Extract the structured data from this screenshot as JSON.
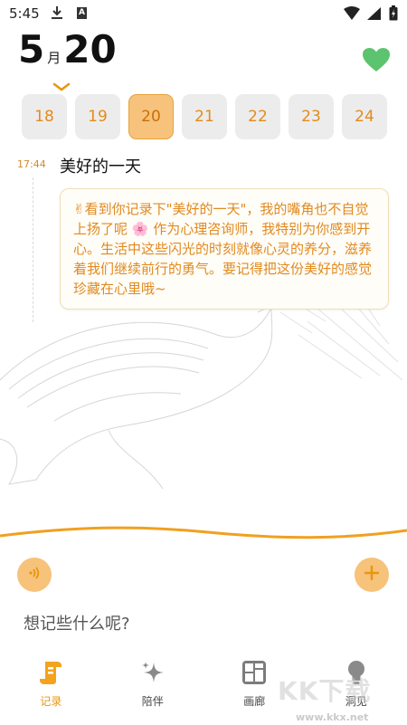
{
  "status_bar": {
    "time": "5:45",
    "a_badge": "A"
  },
  "date": {
    "month": "5",
    "month_suffix": "月",
    "day": "20"
  },
  "week": [
    {
      "label": "18"
    },
    {
      "label": "19"
    },
    {
      "label": "20",
      "active": true
    },
    {
      "label": "21"
    },
    {
      "label": "22"
    },
    {
      "label": "23"
    },
    {
      "label": "24"
    }
  ],
  "entry": {
    "time": "17:44",
    "title": "美好的一天",
    "reply": "✌看到你记录下\"美好的一天\"，我的嘴角也不自觉上扬了呢 🌸 作为心理咨询师，我特别为你感到开心。生活中这些闪光的时刻就像心灵的养分，滋养着我们继续前行的勇气。要记得把这份美好的感觉珍藏在心里哦~"
  },
  "input": {
    "placeholder": "想记些什么呢?"
  },
  "nav": {
    "record": "记录",
    "companion": "陪伴",
    "gallery": "画廊",
    "insight": "洞见"
  },
  "watermark": {
    "text": "KK下载",
    "url": "www.kkx.net"
  },
  "colors": {
    "accent": "#f7c27a",
    "accent_text": "#e08a20",
    "heart": "#5cc36f"
  }
}
